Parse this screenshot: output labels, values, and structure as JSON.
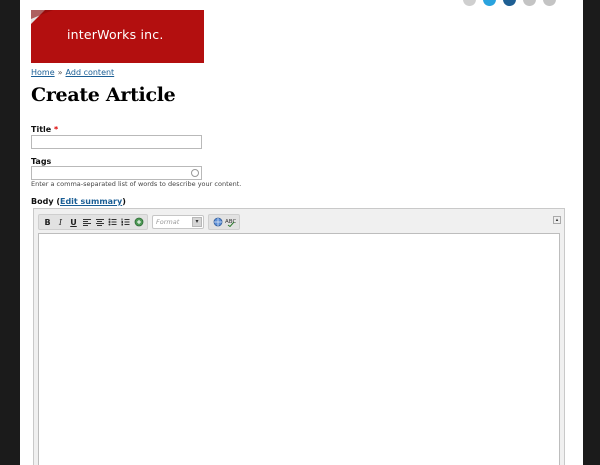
{
  "header": {
    "logo_text": "interWorks inc.",
    "social_colors": [
      "#cfcfcf",
      "#2aa3de",
      "#1e5f93",
      "#c4c4c4",
      "#c4c4c4"
    ],
    "social_icons": [
      "social-icon",
      "twitter-icon",
      "linkedin-icon",
      "social-icon",
      "social-icon"
    ]
  },
  "breadcrumb": {
    "home": "Home",
    "separator": "»",
    "current": "Add content"
  },
  "page_title": "Create Article",
  "form": {
    "title": {
      "label": "Title",
      "required_mark": "*",
      "value": ""
    },
    "tags": {
      "label": "Tags",
      "value": "",
      "description": "Enter a comma-separated list of words to describe your content."
    },
    "body": {
      "label_prefix": "Body (",
      "edit_summary": "Edit summary",
      "label_suffix": ")"
    }
  },
  "editor": {
    "toolbar": {
      "bold": "B",
      "italic": "I",
      "underline": "U",
      "format_placeholder": "Format",
      "format_arrow": "▾",
      "collapse": "▴"
    },
    "body_text": ""
  },
  "colors": {
    "page_bg": "#1b1b1b",
    "logo_red": "#b30f0f",
    "link": "#1a5e95",
    "required": "#dd0000"
  }
}
